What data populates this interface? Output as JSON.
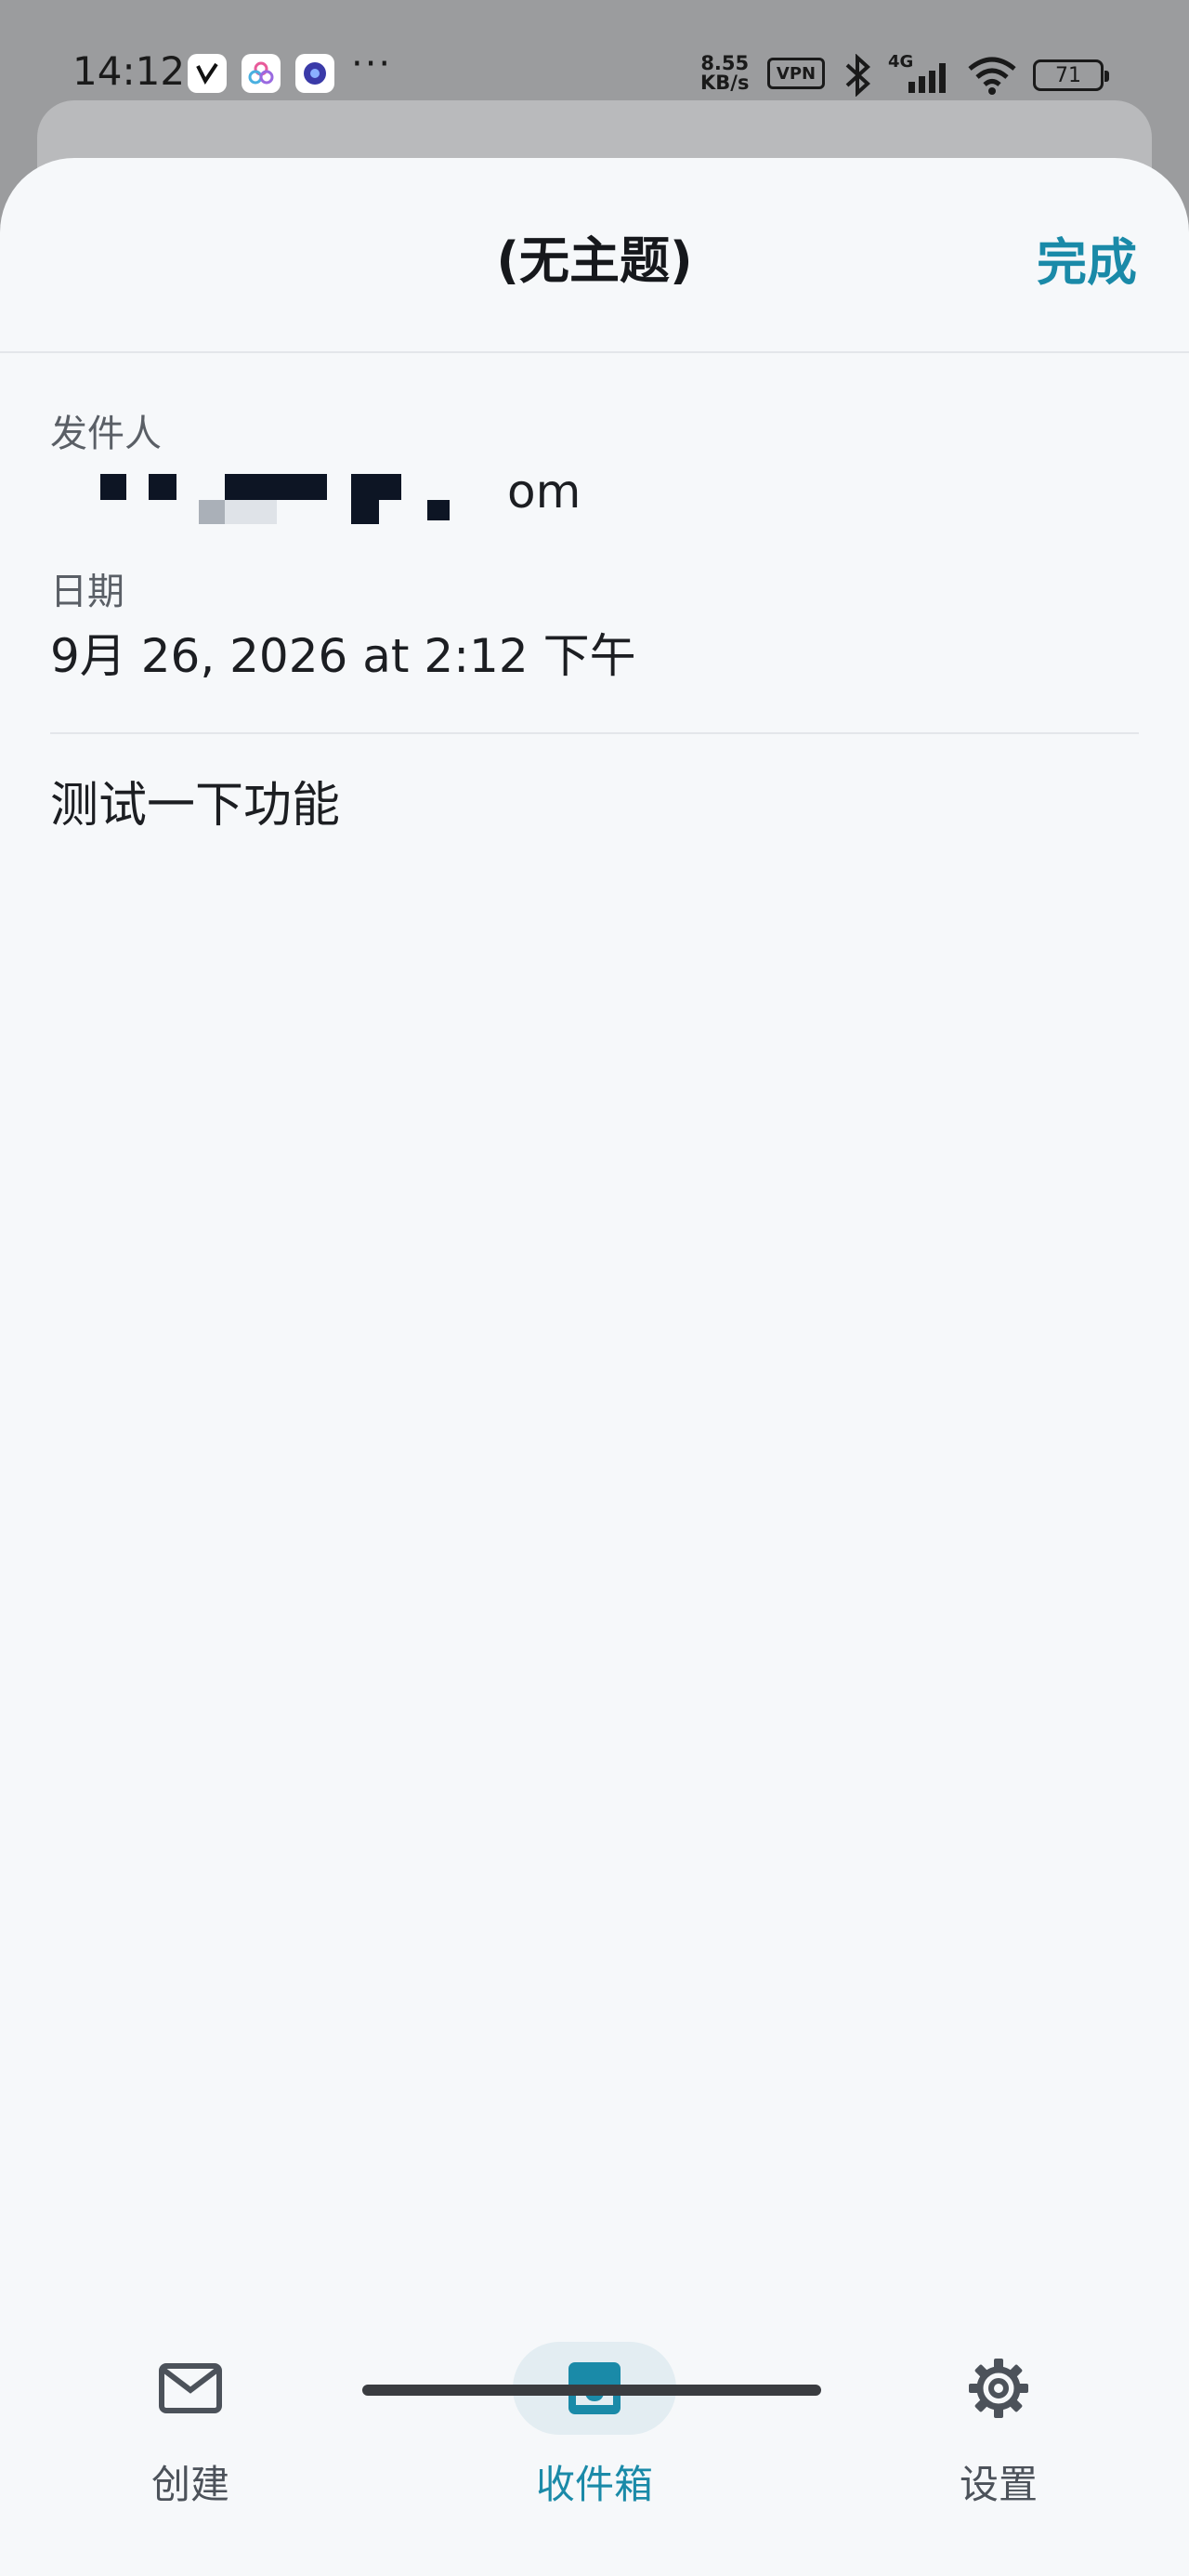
{
  "status_bar": {
    "time": "14:12",
    "more": "···",
    "speed_value": "8.55",
    "speed_unit": "KB/s",
    "vpn": "VPN",
    "network": "4G",
    "battery": "71"
  },
  "header": {
    "title": "(无主题)",
    "done_label": "完成"
  },
  "message": {
    "from_label": "发件人",
    "from_value_tail": "om",
    "date_label": "日期",
    "date_value": "9月 26, 2026 at 2:12 下午",
    "body": "测试一下功能"
  },
  "nav": {
    "items": [
      {
        "label": "创建",
        "icon": "mail-icon",
        "active": false
      },
      {
        "label": "收件箱",
        "icon": "inbox-icon",
        "active": true
      },
      {
        "label": "设置",
        "icon": "gear-icon",
        "active": false
      }
    ]
  },
  "colors": {
    "accent": "#1a8aa8",
    "background": "#f6f8fa",
    "active_pill": "#e3edf2"
  }
}
